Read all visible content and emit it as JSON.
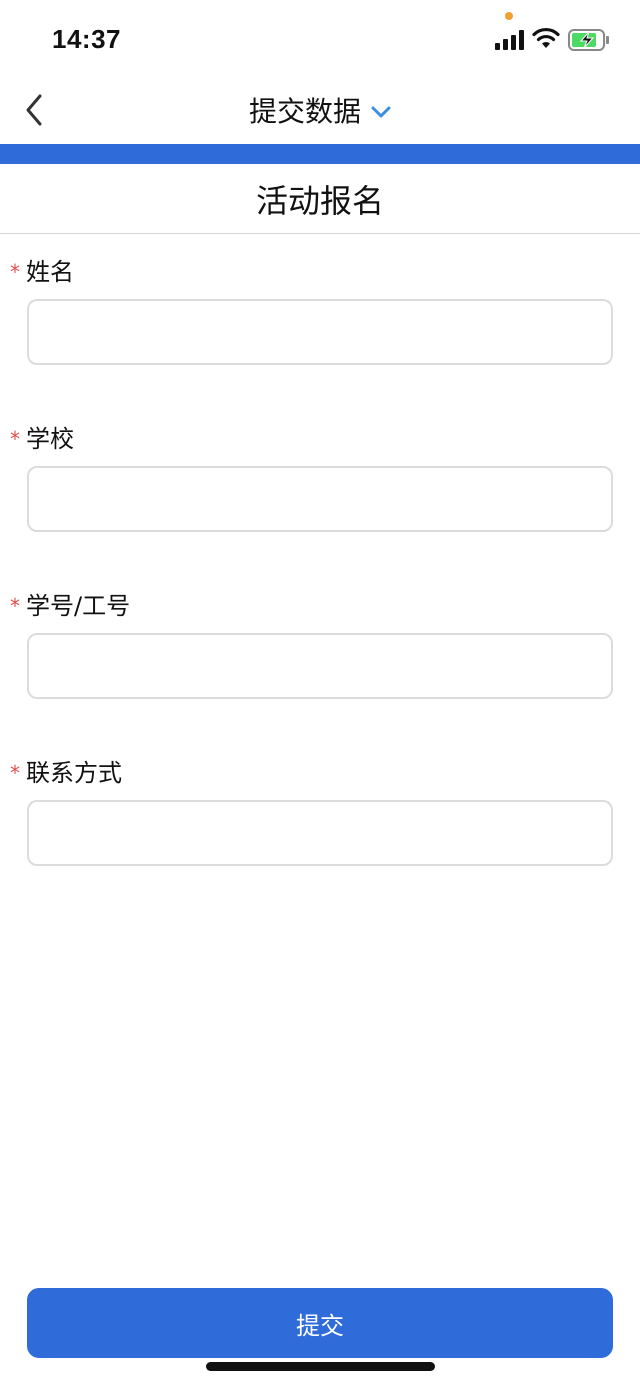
{
  "status_bar": {
    "time": "14:37",
    "icons": [
      "signal-icon",
      "wifi-icon",
      "battery-charging-icon"
    ],
    "colors": {
      "battery_fill": "#4cd964",
      "indicator_dot": "#f0a030"
    }
  },
  "nav": {
    "title": "提交数据",
    "back_icon": "chevron-left-icon",
    "title_dropdown_icon": "chevron-down-icon"
  },
  "form": {
    "title": "活动报名",
    "required_marker": "*",
    "fields": [
      {
        "label": "姓名",
        "value": "",
        "placeholder": ""
      },
      {
        "label": "学校",
        "value": "",
        "placeholder": ""
      },
      {
        "label": "学号/工号",
        "value": "",
        "placeholder": ""
      },
      {
        "label": "联系方式",
        "value": "",
        "placeholder": ""
      }
    ],
    "submit_label": "提交"
  },
  "colors": {
    "accent": "#2f6bd9",
    "required": "#e34d4d",
    "chevron": "#3a8ee6"
  }
}
